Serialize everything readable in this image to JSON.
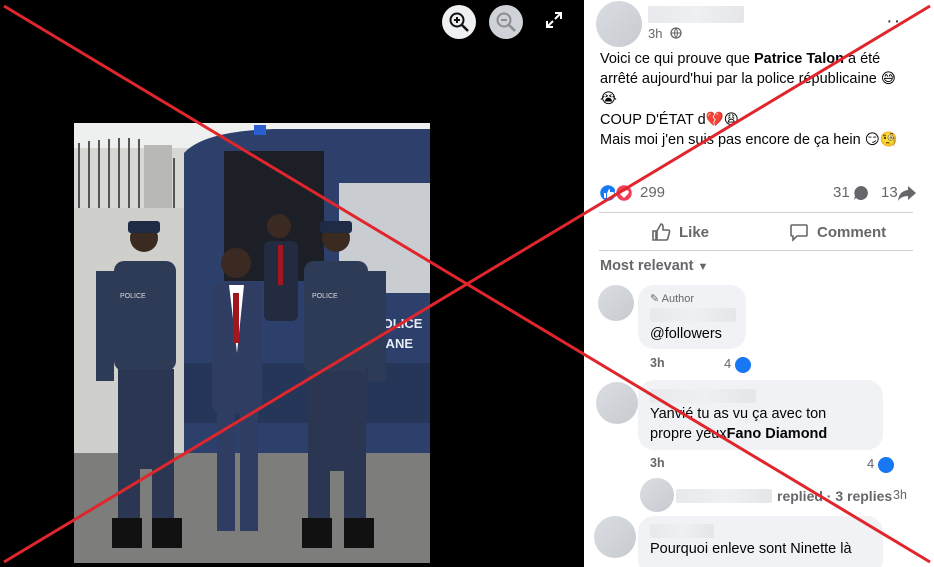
{
  "post": {
    "time": "3h",
    "privacy_icon": "globe-icon",
    "text_lines": [
      {
        "pre": "Voici ce qui prouve que ",
        "bold": "Patrice Talon",
        "post": " a été"
      },
      {
        "pre": "arrêté aujourd'hui par la police républicaine 😅",
        "bold": "",
        "post": ""
      },
      {
        "pre": "😭",
        "bold": "",
        "post": ""
      },
      {
        "pre": "COUP D'ÉTAT d💔😩",
        "bold": "",
        "post": ""
      },
      {
        "pre": "Mais moi j'en suis pas encore de ça hein 😏🧐",
        "bold": "",
        "post": ""
      }
    ],
    "reaction_count": "299",
    "comment_count": "31",
    "share_count": "13",
    "like_label": "Like",
    "comment_label": "Comment",
    "sort_label": "Most relevant"
  },
  "photo": {
    "van_text_1": "POLICE",
    "van_text_2": "RÉPUBLICAINE",
    "badge_text": "POLICE"
  },
  "comments": [
    {
      "author_badge": "Author",
      "text": "@followers",
      "time": "3h",
      "likes": "4"
    },
    {
      "text_pre": "Yanvié tu as vu ça avec ton",
      "text_line2_pre": "propre yeux",
      "text_line2_bold": "Fano Diamond",
      "time": "3h",
      "likes": "4"
    },
    {
      "replies_label": "replied · 3 replies",
      "time": "3h"
    },
    {
      "text": "Pourquoi enleve sont Ninette là"
    }
  ],
  "colors": {
    "accent": "#1877f2",
    "cross": "#e0262d",
    "love": "#f33e58"
  }
}
